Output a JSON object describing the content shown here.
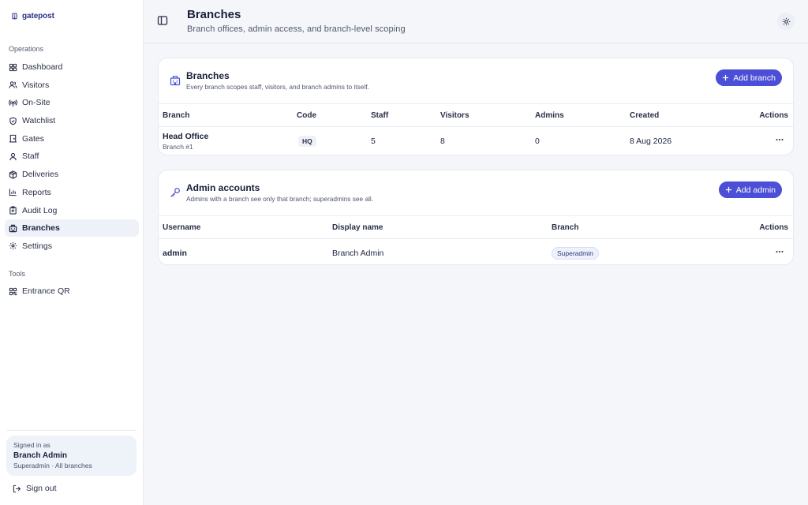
{
  "brand": {
    "name": "gatepost",
    "icon": "building-icon"
  },
  "sidebar": {
    "sections": [
      {
        "label": "Operations",
        "items": [
          {
            "label": "Dashboard",
            "icon": "dashboard-icon"
          },
          {
            "label": "Visitors",
            "icon": "users-icon"
          },
          {
            "label": "On-Site",
            "icon": "radio-icon"
          },
          {
            "label": "Watchlist",
            "icon": "shield-icon"
          },
          {
            "label": "Gates",
            "icon": "door-icon"
          },
          {
            "label": "Staff",
            "icon": "user-icon"
          },
          {
            "label": "Deliveries",
            "icon": "package-icon"
          },
          {
            "label": "Reports",
            "icon": "bar-chart-icon"
          },
          {
            "label": "Audit Log",
            "icon": "clipboard-icon"
          },
          {
            "label": "Branches",
            "icon": "building-icon",
            "active": true
          },
          {
            "label": "Settings",
            "icon": "gear-icon"
          }
        ]
      },
      {
        "label": "Tools",
        "items": [
          {
            "label": "Entrance QR",
            "icon": "qr-code-icon"
          }
        ]
      }
    ],
    "user": {
      "signed_in_label": "Signed in as",
      "name": "Branch Admin",
      "role": "Superadmin · All branches"
    },
    "sign_out_label": "Sign out"
  },
  "header": {
    "title": "Branches",
    "subtitle": "Branch offices, admin access, and branch-level scoping"
  },
  "branches_card": {
    "title": "Branches",
    "subtitle": "Every branch scopes staff, visitors, and branch admins to itself.",
    "add_label": "Add branch",
    "columns": [
      "Branch",
      "Code",
      "Staff",
      "Visitors",
      "Admins",
      "Created",
      "Actions"
    ],
    "rows": [
      {
        "name": "Head Office",
        "sub": "Branch #1",
        "code": "HQ",
        "staff": "5",
        "visitors": "8",
        "admins": "0",
        "created": "8 Aug 2026"
      }
    ]
  },
  "admins_card": {
    "title": "Admin accounts",
    "subtitle": "Admins with a branch see only that branch; superadmins see all.",
    "add_label": "Add admin",
    "columns": [
      "Username",
      "Display name",
      "Branch",
      "Actions"
    ],
    "rows": [
      {
        "username": "admin",
        "display_name": "Branch Admin",
        "branch": "Superadmin"
      }
    ]
  },
  "colors": {
    "accent": "#4b4ed6",
    "brand": "#2b2f8a",
    "active_bg": "#eef1f8"
  }
}
